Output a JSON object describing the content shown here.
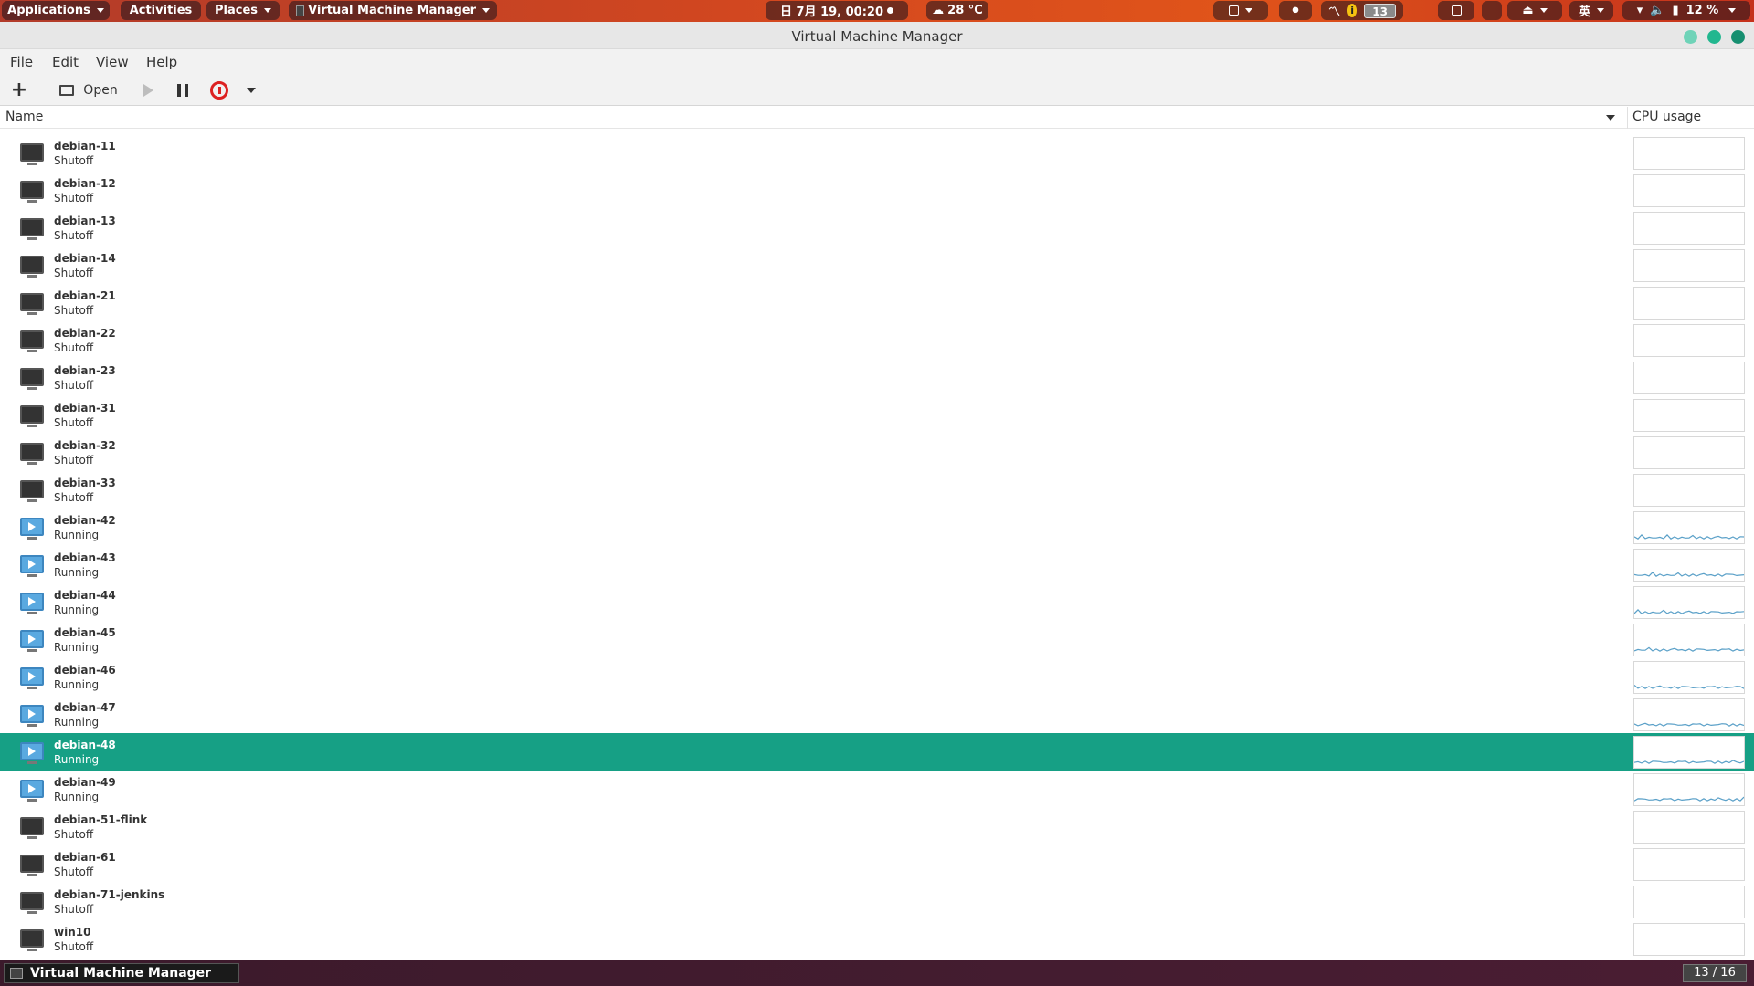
{
  "topbar": {
    "applications": "Applications",
    "activities": "Activities",
    "places": "Places",
    "active_app": "Virtual Machine Manager",
    "clock": "日 7月 19, 00:20",
    "weather": "28 °C",
    "workspace_badge": "13",
    "input_method": "英",
    "battery": "12 %"
  },
  "window": {
    "title": "Virtual Machine Manager",
    "controls_colors": [
      "#6fd3b8",
      "#22b78f",
      "#168f70"
    ]
  },
  "menu": [
    "File",
    "Edit",
    "View",
    "Help"
  ],
  "toolbar": {
    "open_label": "Open"
  },
  "columns": {
    "name": "Name",
    "cpu": "CPU usage"
  },
  "vms": [
    {
      "name": "debian-11",
      "status": "Shutoff",
      "running": false
    },
    {
      "name": "debian-12",
      "status": "Shutoff",
      "running": false
    },
    {
      "name": "debian-13",
      "status": "Shutoff",
      "running": false
    },
    {
      "name": "debian-14",
      "status": "Shutoff",
      "running": false
    },
    {
      "name": "debian-21",
      "status": "Shutoff",
      "running": false
    },
    {
      "name": "debian-22",
      "status": "Shutoff",
      "running": false
    },
    {
      "name": "debian-23",
      "status": "Shutoff",
      "running": false
    },
    {
      "name": "debian-31",
      "status": "Shutoff",
      "running": false
    },
    {
      "name": "debian-32",
      "status": "Shutoff",
      "running": false
    },
    {
      "name": "debian-33",
      "status": "Shutoff",
      "running": false
    },
    {
      "name": "debian-42",
      "status": "Running",
      "running": true
    },
    {
      "name": "debian-43",
      "status": "Running",
      "running": true
    },
    {
      "name": "debian-44",
      "status": "Running",
      "running": true
    },
    {
      "name": "debian-45",
      "status": "Running",
      "running": true
    },
    {
      "name": "debian-46",
      "status": "Running",
      "running": true
    },
    {
      "name": "debian-47",
      "status": "Running",
      "running": true
    },
    {
      "name": "debian-48",
      "status": "Running",
      "running": true,
      "selected": true
    },
    {
      "name": "debian-49",
      "status": "Running",
      "running": true
    },
    {
      "name": "debian-51-flink",
      "status": "Shutoff",
      "running": false
    },
    {
      "name": "debian-61",
      "status": "Shutoff",
      "running": false
    },
    {
      "name": "debian-71-jenkins",
      "status": "Shutoff",
      "running": false
    },
    {
      "name": "win10",
      "status": "Shutoff",
      "running": false
    }
  ],
  "taskbar": {
    "task_label": "Virtual Machine Manager",
    "workspace": "13 / 16"
  },
  "colors": {
    "selection": "#16a085",
    "cpu_line": "#5aa0c8",
    "vm_running": "#5aa9e0"
  }
}
